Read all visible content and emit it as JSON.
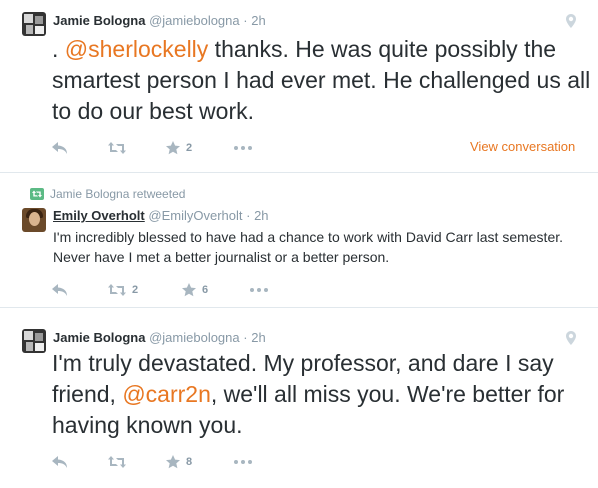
{
  "tweets": [
    {
      "author_name": "Jamie Bologna",
      "author_handle": "@jamiebologna",
      "separator": "·",
      "time": "2h",
      "text_prefix": ". ",
      "mention": "@sherlockelly",
      "text_suffix": " thanks. He was quite possibly the smartest person I had ever met. He challenged us all to do our best work.",
      "retweet_count": "",
      "favorite_count": "2",
      "view_conversation": "View conversation",
      "icons": [
        "reply-icon",
        "retweet-icon",
        "star-icon",
        "more-icon",
        "geo-pin-icon"
      ]
    },
    {
      "retweet_context": "Jamie Bologna retweeted",
      "author_name": "Emily Overholt",
      "author_handle": "@EmilyOverholt",
      "separator": "·",
      "time": "2h",
      "text": "I'm incredibly blessed to have had a chance to work with David Carr last semester. Never have I met a better journalist or a better person.",
      "retweet_count": "2",
      "favorite_count": "6",
      "icons": [
        "reply-icon",
        "retweet-icon",
        "star-icon",
        "more-icon"
      ]
    },
    {
      "author_name": "Jamie Bologna",
      "author_handle": "@jamiebologna",
      "separator": "·",
      "time": "2h",
      "text_prefix": "I'm truly devastated. My professor, and dare I say friend, ",
      "mention": "@carr2n",
      "text_suffix": ", we'll all miss you. We're better for having known you.",
      "retweet_count": "",
      "favorite_count": "8",
      "icons": [
        "reply-icon",
        "retweet-icon",
        "star-icon",
        "more-icon",
        "geo-pin-icon"
      ]
    }
  ],
  "colors": {
    "link": "#e87722",
    "muted": "#8899a6",
    "retweet_green": "#5cba85",
    "text": "#292f33",
    "divider": "#e1e8ed"
  }
}
